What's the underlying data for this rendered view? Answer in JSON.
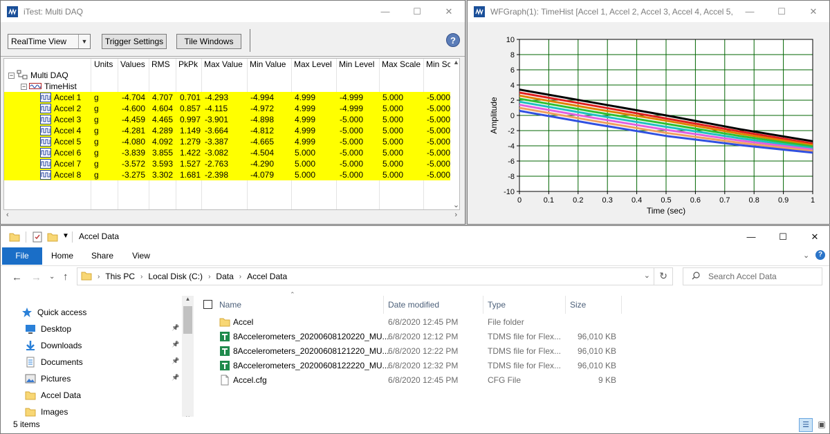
{
  "itest": {
    "title": "iTest: Multi DAQ",
    "view_select": "RealTime View",
    "trigger_button": "Trigger Settings",
    "tile_button": "Tile Windows",
    "help_glyph": "?",
    "columns": [
      "Units",
      "Values",
      "RMS",
      "PkPk",
      "Max Value",
      "Min Value",
      "Max Level",
      "Min Level",
      "Max Scale",
      "Min Sc"
    ],
    "root_node": "Multi DAQ",
    "group_node": "TimeHist",
    "rows": [
      {
        "name": "Accel 1",
        "units": "g",
        "values": "-4.704",
        "rms": "4.707",
        "pkpk": "0.701",
        "max_value": "-4.293",
        "min_value": "-4.994",
        "max_level": "4.999",
        "min_level": "-4.999",
        "max_scale": "5.000",
        "min_scale": "-5.000"
      },
      {
        "name": "Accel 2",
        "units": "g",
        "values": "-4.600",
        "rms": "4.604",
        "pkpk": "0.857",
        "max_value": "-4.115",
        "min_value": "-4.972",
        "max_level": "4.999",
        "min_level": "-4.999",
        "max_scale": "5.000",
        "min_scale": "-5.000"
      },
      {
        "name": "Accel 3",
        "units": "g",
        "values": "-4.459",
        "rms": "4.465",
        "pkpk": "0.997",
        "max_value": "-3.901",
        "min_value": "-4.898",
        "max_level": "4.999",
        "min_level": "-5.000",
        "max_scale": "5.000",
        "min_scale": "-5.000"
      },
      {
        "name": "Accel 4",
        "units": "g",
        "values": "-4.281",
        "rms": "4.289",
        "pkpk": "1.149",
        "max_value": "-3.664",
        "min_value": "-4.812",
        "max_level": "4.999",
        "min_level": "-5.000",
        "max_scale": "5.000",
        "min_scale": "-5.000"
      },
      {
        "name": "Accel 5",
        "units": "g",
        "values": "-4.080",
        "rms": "4.092",
        "pkpk": "1.279",
        "max_value": "-3.387",
        "min_value": "-4.665",
        "max_level": "4.999",
        "min_level": "-5.000",
        "max_scale": "5.000",
        "min_scale": "-5.000"
      },
      {
        "name": "Accel 6",
        "units": "g",
        "values": "-3.839",
        "rms": "3.855",
        "pkpk": "1.422",
        "max_value": "-3.082",
        "min_value": "-4.504",
        "max_level": "5.000",
        "min_level": "-5.000",
        "max_scale": "5.000",
        "min_scale": "-5.000"
      },
      {
        "name": "Accel 7",
        "units": "g",
        "values": "-3.572",
        "rms": "3.593",
        "pkpk": "1.527",
        "max_value": "-2.763",
        "min_value": "-4.290",
        "max_level": "5.000",
        "min_level": "-5.000",
        "max_scale": "5.000",
        "min_scale": "-5.000"
      },
      {
        "name": "Accel 8",
        "units": "g",
        "values": "-3.275",
        "rms": "3.302",
        "pkpk": "1.681",
        "max_value": "-2.398",
        "min_value": "-4.079",
        "max_level": "5.000",
        "min_level": "-5.000",
        "max_scale": "5.000",
        "min_scale": "-5.000"
      }
    ],
    "highlight_color": "#ffff00"
  },
  "graph": {
    "title": "WFGraph(1): TimeHist [Accel 1, Accel 2, Accel 3, Accel 4, Accel 5, ..."
  },
  "chart_data": {
    "type": "line",
    "title": "",
    "xlabel": "Time (sec)",
    "ylabel": "Amplitude",
    "xlim": [
      0,
      1
    ],
    "ylim": [
      -10,
      10
    ],
    "x_ticks": [
      "0",
      "0.1",
      "0.2",
      "0.3",
      "0.4",
      "0.5",
      "0.6",
      "0.7",
      "0.8",
      "0.9",
      "1"
    ],
    "y_ticks": [
      "10",
      "8",
      "6",
      "4",
      "2",
      "0",
      "-2",
      "-4",
      "-6",
      "-8",
      "-10"
    ],
    "grid": true,
    "x": [
      0,
      0.25,
      0.5,
      0.75,
      1
    ],
    "series": [
      {
        "color": "#000000",
        "values": [
          3.4,
          1.7,
          0.0,
          -1.8,
          -3.4
        ]
      },
      {
        "color": "#e02020",
        "values": [
          3.0,
          1.3,
          -0.4,
          -2.1,
          -3.7
        ]
      },
      {
        "color": "#e08000",
        "values": [
          2.6,
          0.9,
          -0.7,
          -2.4,
          -3.9
        ]
      },
      {
        "color": "#30c030",
        "values": [
          2.2,
          0.5,
          -1.1,
          -2.7,
          -4.1
        ]
      },
      {
        "color": "#20c0c0",
        "values": [
          1.8,
          0.1,
          -1.5,
          -3.0,
          -4.3
        ]
      },
      {
        "color": "#e060e0",
        "values": [
          1.4,
          -0.3,
          -1.9,
          -3.3,
          -4.5
        ]
      },
      {
        "color": "#f0a060",
        "values": [
          1.0,
          -0.7,
          -2.3,
          -3.6,
          -4.7
        ]
      },
      {
        "color": "#3050e0",
        "values": [
          0.6,
          -1.1,
          -2.7,
          -3.9,
          -4.9
        ]
      }
    ]
  },
  "explorer": {
    "title": "Accel Data",
    "tabs": [
      "File",
      "Home",
      "Share",
      "View"
    ],
    "breadcrumb": [
      "This PC",
      "Local Disk (C:)",
      "Data",
      "Accel Data"
    ],
    "search_placeholder": "Search Accel Data",
    "nav": [
      {
        "label": "Quick access",
        "icon": "star-icon",
        "pinned": false
      },
      {
        "label": "Desktop",
        "icon": "desktop-icon",
        "pinned": true
      },
      {
        "label": "Downloads",
        "icon": "download-icon",
        "pinned": true
      },
      {
        "label": "Documents",
        "icon": "documents-icon",
        "pinned": true
      },
      {
        "label": "Pictures",
        "icon": "pictures-icon",
        "pinned": true
      },
      {
        "label": "Accel Data",
        "icon": "folder-icon",
        "pinned": false
      },
      {
        "label": "Images",
        "icon": "folder-icon",
        "pinned": false
      }
    ],
    "columns": [
      "Name",
      "Date modified",
      "Type",
      "Size"
    ],
    "files": [
      {
        "name": "Accel",
        "date": "6/8/2020 12:45 PM",
        "type": "File folder",
        "size": "",
        "icon": "folder-icon"
      },
      {
        "name": "8Accelerometers_20200608120220_MU...",
        "date": "6/8/2020 12:12 PM",
        "type": "TDMS file for Flex...",
        "size": "96,010 KB",
        "icon": "tdms-icon"
      },
      {
        "name": "8Accelerometers_20200608121220_MU...",
        "date": "6/8/2020 12:22 PM",
        "type": "TDMS file for Flex...",
        "size": "96,010 KB",
        "icon": "tdms-icon"
      },
      {
        "name": "8Accelerometers_20200608122220_MU...",
        "date": "6/8/2020 12:32 PM",
        "type": "TDMS file for Flex...",
        "size": "96,010 KB",
        "icon": "tdms-icon"
      },
      {
        "name": "Accel.cfg",
        "date": "6/8/2020 12:45 PM",
        "type": "CFG File",
        "size": "9 KB",
        "icon": "file-icon"
      }
    ],
    "status": "5 items"
  }
}
